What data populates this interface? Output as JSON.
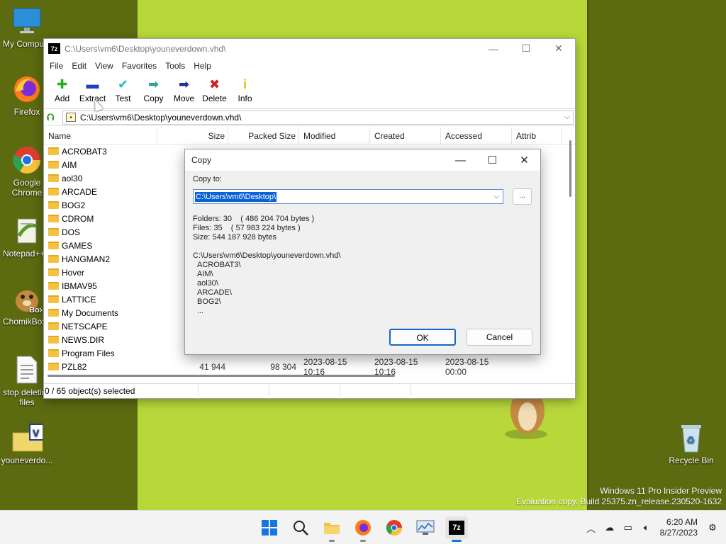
{
  "desktop": {
    "icons": [
      {
        "name": "desktop-icon-my-computer",
        "label": "My Computer",
        "icon": "monitor-icon"
      },
      {
        "name": "desktop-icon-firefox",
        "label": "Firefox",
        "icon": "firefox-icon"
      },
      {
        "name": "desktop-icon-google-chrome",
        "label": "Google Chrome",
        "icon": "chrome-icon"
      },
      {
        "name": "desktop-icon-notepad",
        "label": "Notepad++",
        "icon": "notepad-icon"
      },
      {
        "name": "desktop-icon-chomikbox",
        "label": "ChomikBox",
        "icon": "hamster-icon"
      },
      {
        "name": "desktop-icon-stop-deleting",
        "label": "stop deleting files",
        "icon": "text-file-icon"
      },
      {
        "name": "desktop-icon-youneverdown",
        "label": "youneverdo...",
        "icon": "vhd-file-icon"
      },
      {
        "name": "desktop-icon-recycle-bin",
        "label": "Recycle Bin",
        "icon": "recycle-bin-icon"
      }
    ]
  },
  "zip": {
    "title": "C:\\Users\\vm6\\Desktop\\youneverdown.vhd\\",
    "app_icon": "7z",
    "menu": [
      "File",
      "Edit",
      "View",
      "Favorites",
      "Tools",
      "Help"
    ],
    "toolbar": [
      {
        "label": "Add",
        "icon": "plus-icon",
        "glyph": "✚",
        "color": "#1fae1f"
      },
      {
        "label": "Extract",
        "icon": "minus-icon",
        "glyph": "▬",
        "color": "#1f3fbf"
      },
      {
        "label": "Test",
        "icon": "check-icon",
        "glyph": "✔",
        "color": "#29b7c7"
      },
      {
        "label": "Copy",
        "icon": "copy-arrow-icon",
        "glyph": "➡",
        "color": "#2aa39c"
      },
      {
        "label": "Move",
        "icon": "move-arrow-icon",
        "glyph": "➡",
        "color": "#1c2f9c"
      },
      {
        "label": "Delete",
        "icon": "delete-x-icon",
        "glyph": "✖",
        "color": "#d12020"
      },
      {
        "label": "Info",
        "icon": "info-icon",
        "glyph": "i",
        "color": "#e0c000"
      }
    ],
    "address": "C:\\Users\\vm6\\Desktop\\youneverdown.vhd\\",
    "columns": [
      "Name",
      "Size",
      "Packed Size",
      "Modified",
      "Created",
      "Accessed",
      "Attrib"
    ],
    "rows": [
      {
        "name": "ACROBAT3",
        "size": "",
        "packed": "",
        "modified": "",
        "created": "",
        "accessed": ""
      },
      {
        "name": "AIM",
        "size": "",
        "packed": "",
        "modified": "",
        "created": "",
        "accessed": ""
      },
      {
        "name": "aol30",
        "size": "",
        "packed": "",
        "modified": "",
        "created": "",
        "accessed": ""
      },
      {
        "name": "ARCADE",
        "size": "",
        "packed": "",
        "modified": "",
        "created": "",
        "accessed": ""
      },
      {
        "name": "BOG2",
        "size": "",
        "packed": "",
        "modified": "",
        "created": "",
        "accessed": ""
      },
      {
        "name": "CDROM",
        "size": "",
        "packed": "",
        "modified": "",
        "created": "",
        "accessed": ""
      },
      {
        "name": "DOS",
        "size": "",
        "packed": "",
        "modified": "",
        "created": "",
        "accessed": ""
      },
      {
        "name": "GAMES",
        "size": "",
        "packed": "",
        "modified": "",
        "created": "",
        "accessed": ""
      },
      {
        "name": "HANGMAN2",
        "size": "",
        "packed": "",
        "modified": "",
        "created": "",
        "accessed": ""
      },
      {
        "name": "Hover",
        "size": "",
        "packed": "",
        "modified": "",
        "created": "",
        "accessed": ""
      },
      {
        "name": "IBMAV95",
        "size": "",
        "packed": "",
        "modified": "",
        "created": "",
        "accessed": ""
      },
      {
        "name": "LATTICE",
        "size": "",
        "packed": "",
        "modified": "",
        "created": "",
        "accessed": ""
      },
      {
        "name": "My Documents",
        "size": "",
        "packed": "",
        "modified": "",
        "created": "",
        "accessed": ""
      },
      {
        "name": "NETSCAPE",
        "size": "",
        "packed": "",
        "modified": "",
        "created": "",
        "accessed": ""
      },
      {
        "name": "NEWS.DIR",
        "size": "",
        "packed": "",
        "modified": "",
        "created": "",
        "accessed": ""
      },
      {
        "name": "Program Files",
        "size": "",
        "packed": "",
        "modified": "",
        "created": "",
        "accessed": ""
      },
      {
        "name": "PZL82",
        "size": "41 944",
        "packed": "98 304",
        "modified": "2023-08-15 10:16",
        "created": "2023-08-15 10:16",
        "accessed": "2023-08-15 00:00"
      }
    ],
    "status": "0 / 65 object(s) selected"
  },
  "copy_dialog": {
    "title": "Copy",
    "copy_to_label": "Copy to:",
    "copy_to_value": "C:\\Users\\vm6\\Desktop\\",
    "browse_label": "...",
    "info": [
      "Folders: 30    ( 486 204 704 bytes )",
      "Files: 35    ( 57 983 224 bytes )",
      "Size: 544 187 928 bytes"
    ],
    "source_path": "C:\\Users\\vm6\\Desktop\\youneverdown.vhd\\",
    "items": [
      "ACROBAT3\\",
      "AIM\\",
      "aol30\\",
      "ARCADE\\",
      "BOG2\\",
      "..."
    ],
    "ok_label": "OK",
    "cancel_label": "Cancel"
  },
  "watermark": {
    "line1": "Windows 11 Pro Insider Preview",
    "line2": "Evaluation copy. Build 25375.zn_release.230520-1632"
  },
  "taskbar": {
    "apps": [
      {
        "name": "start-button",
        "icon": "windows-logo-icon"
      },
      {
        "name": "taskbar-search",
        "icon": "search-icon"
      },
      {
        "name": "taskbar-file-explorer",
        "icon": "folder-icon"
      },
      {
        "name": "taskbar-firefox",
        "icon": "firefox-icon"
      },
      {
        "name": "taskbar-chrome",
        "icon": "chrome-icon"
      },
      {
        "name": "taskbar-monitor",
        "icon": "monitor-chart-icon"
      },
      {
        "name": "taskbar-7zip",
        "icon": "7zip-icon",
        "label": "7z"
      }
    ],
    "time": "6:20 AM",
    "date": "8/27/2023"
  }
}
